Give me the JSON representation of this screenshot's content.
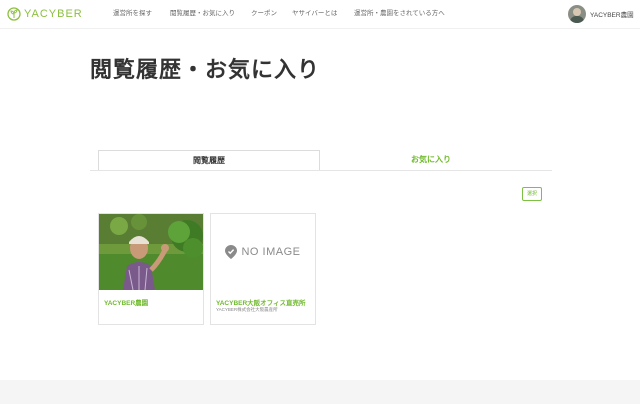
{
  "header": {
    "logo_text": "YACYBER",
    "nav": [
      {
        "label": "運営所を探す"
      },
      {
        "label": "閲覧履歴・お気に入り"
      },
      {
        "label": "クーポン"
      },
      {
        "label": "ヤサイバーとは"
      },
      {
        "label": "運営所・農園をされている方へ"
      }
    ],
    "user_name": "YACYBER農園"
  },
  "page": {
    "title": "閲覧履歴・お気に入り"
  },
  "tabs": [
    {
      "label": "閲覧履歴",
      "active": true
    },
    {
      "label": "お気に入り",
      "active": false
    }
  ],
  "select_button": "選択",
  "cards": [
    {
      "title": "YACYBER農園",
      "subtitle": "",
      "image": "farmer-photo"
    },
    {
      "title": "YACYBER大阪オフィス直売所",
      "subtitle": "YACYBER株式会社大阪農産所",
      "image": "no-image",
      "no_image_text": "NO IMAGE"
    }
  ],
  "colors": {
    "accent": "#6fb92c",
    "logo": "#8cbf3f",
    "footer": "#f5f5f5"
  }
}
